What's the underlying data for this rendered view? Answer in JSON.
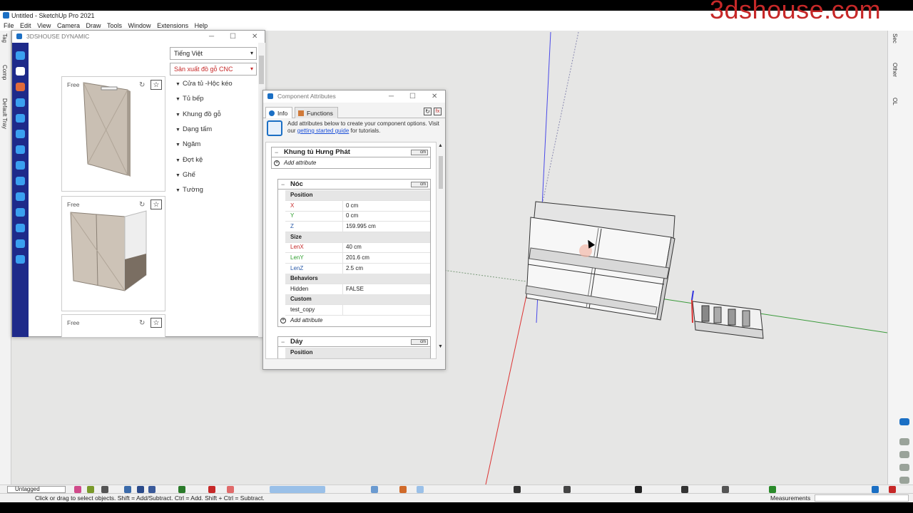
{
  "window": {
    "title": "Untitled - SketchUp Pro 2021",
    "watermark": "3dshouse.com"
  },
  "menu": [
    "File",
    "Edit",
    "View",
    "Camera",
    "Draw",
    "Tools",
    "Window",
    "Extensions",
    "Help"
  ],
  "left_tray_tabs": [
    "Tag",
    "Comp",
    "Default Tray"
  ],
  "right_tray_tabs": [
    "Sec",
    "Other",
    "OL"
  ],
  "dynamic_panel": {
    "title": "3DSHOUSE DYNAMIC",
    "language": "Tiếng Việt",
    "category_select": "Sản xuất đồ gỗ CNC",
    "categories": [
      "Cửa tủ -Hộc kéo",
      "Tủ bếp",
      "Khung đồ gỗ",
      "Dạng tấm",
      "Ngăm",
      "Đợt kệ",
      "Ghế",
      "Tường"
    ],
    "card_label": "Free"
  },
  "attributes_panel": {
    "title": "Component Attributes",
    "tab_info": "Info",
    "tab_functions": "Functions",
    "info_text_1": "Add attributes below to create your component options. Visit our ",
    "info_link": "getting started guide",
    "info_text_2": " for tutorials.",
    "unit_label": "cm",
    "add_attribute": "Add attribute",
    "root_group": "Khung tủ Hưng Phát",
    "group_noc": {
      "name": "Nóc",
      "sections": {
        "position": "Position",
        "size": "Size",
        "behaviors": "Behaviors",
        "custom": "Custom"
      },
      "rows": {
        "x": {
          "k": "X",
          "v": "0 cm"
        },
        "y": {
          "k": "Y",
          "v": "0 cm"
        },
        "z": {
          "k": "Z",
          "v": "159.995 cm"
        },
        "lenx": {
          "k": "LenX",
          "v": "40 cm"
        },
        "leny": {
          "k": "LenY",
          "v": "201.6 cm"
        },
        "lenz": {
          "k": "LenZ",
          "v": "2.5 cm"
        },
        "hidden": {
          "k": "Hidden",
          "v": "FALSE"
        },
        "test_copy": {
          "k": "test_copy",
          "v": ""
        }
      }
    },
    "group_day": {
      "name": "Dáy",
      "section": "Position"
    }
  },
  "toolbar": {
    "layer": "Untagged"
  },
  "status": {
    "hint": "Click or drag to select objects. Shift = Add/Subtract. Ctrl = Add. Shift + Ctrl = Subtract.",
    "measurements_label": "Measurements"
  }
}
